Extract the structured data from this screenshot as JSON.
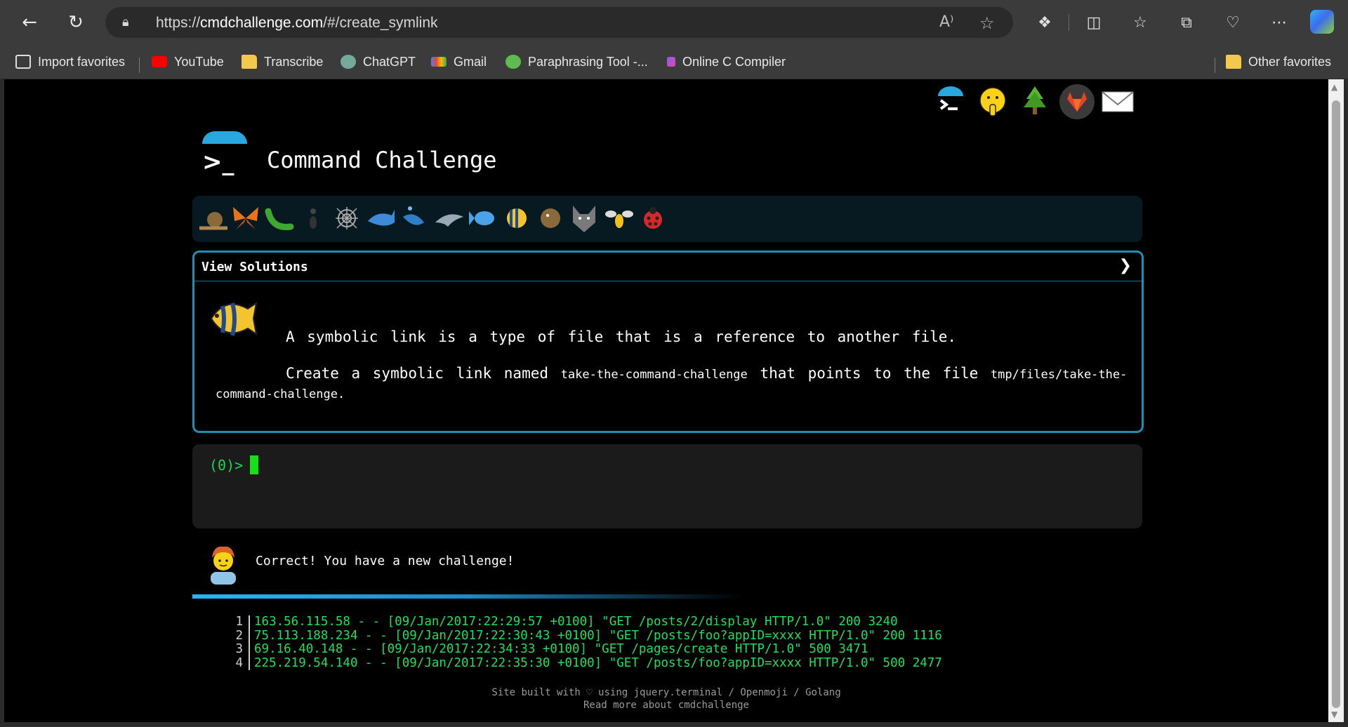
{
  "browser": {
    "url_prefix": "https://",
    "url_host": "cmdchallenge.com",
    "url_path": "/#/create_symlink",
    "read_aloud": "A⁾",
    "favorite_star": "☆"
  },
  "bookmarks": {
    "import_favorites": "Import favorites",
    "items": [
      "YouTube",
      "Transcribe",
      "ChatGPT",
      "Gmail",
      "Paraphrasing Tool -...",
      "Online C Compiler"
    ],
    "other_favorites": "Other favorites"
  },
  "page": {
    "title": "Command Challenge",
    "panel_header": "View Solutions",
    "description_line1": "A symbolic link is a type of file that is a reference to another file.",
    "description_create": "Create a symbolic link named",
    "link_name": "take-the-command-challenge",
    "description_points": "that points to the file",
    "target_path_part1": "tmp/files/take-the-",
    "target_path_part2": "command-challenge",
    "period": ".",
    "prompt": "(0)>",
    "message": "Correct! You have a new challenge!",
    "progress_fraction": 0.58,
    "log_lines": [
      {
        "num": "1",
        "text": "163.56.115.58 - - [09/Jan/2017:22:29:57 +0100] \"GET /posts/2/display HTTP/1.0\" 200 3240"
      },
      {
        "num": "2",
        "text": "75.113.188.234 - - [09/Jan/2017:22:30:43 +0100] \"GET /posts/foo?appID=xxxx HTTP/1.0\" 200 1116"
      },
      {
        "num": "3",
        "text": "69.16.40.148 - - [09/Jan/2017:22:34:33 +0100] \"GET /pages/create HTTP/1.0\" 500 3471"
      },
      {
        "num": "4",
        "text": "225.219.54.140 - - [09/Jan/2017:22:35:30 +0100] \"GET /posts/foo?appID=xxxx HTTP/1.0\" 500 2477"
      }
    ],
    "footer_line1": "Site built with ♡ using jquery.terminal / Openmoji / Golang",
    "footer_line2": "Read more about cmdchallenge"
  },
  "colors": {
    "accent_blue": "#29a8e0",
    "terminal_green": "#1fe05a",
    "panel_border": "#1d8fb3"
  }
}
